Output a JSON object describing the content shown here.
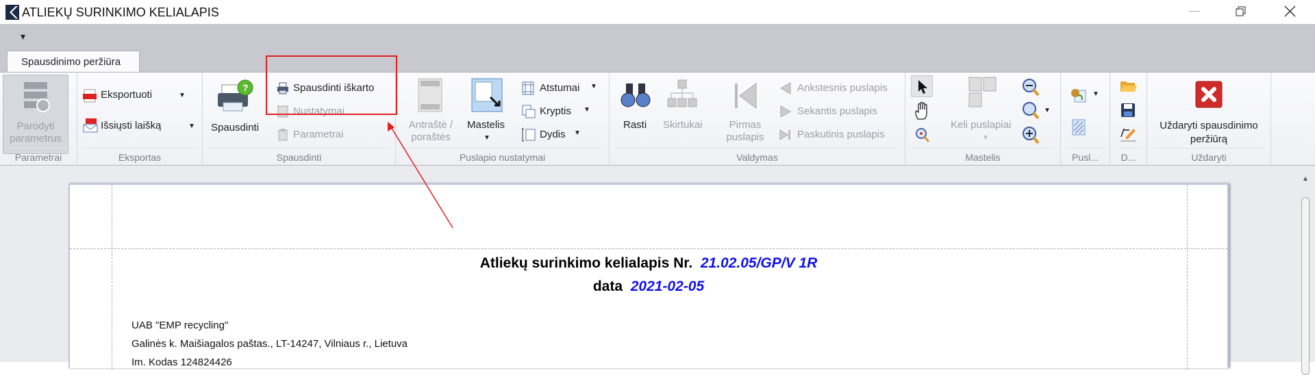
{
  "window": {
    "title": "ATLIEKŲ SURINKIMO KELIALAPIS"
  },
  "qat": {
    "customize": "▾"
  },
  "tabs": [
    {
      "label": "Spausdinimo peržiūra"
    }
  ],
  "groups": {
    "parametrai": {
      "label": "Parametrai",
      "show_params": "Parodyti parametrus"
    },
    "eksportas": {
      "label": "Eksportas",
      "export": "Eksportuoti",
      "send": "Išsiųsti laišką"
    },
    "spausdinti": {
      "label": "Spausdinti",
      "print": "Spausdinti",
      "print_now": "Spausdinti iškarto",
      "settings": "Nustatymai",
      "params": "Parametrai"
    },
    "puslapio": {
      "label": "Puslapio nustatymai",
      "header_footer": "Antraštė / poraštės",
      "scale": "Mastelis",
      "margins": "Atstumai",
      "orientation": "Kryptis",
      "size": "Dydis"
    },
    "valdymas": {
      "label": "Valdymas",
      "find": "Rasti",
      "bookmarks": "Skirtukai",
      "first": "Pirmas puslapis",
      "prev": "Ankstesnis puslapis",
      "next": "Sekantis puslapis",
      "last": "Paskutinis puslapis"
    },
    "mastelis": {
      "label": "Mastelis",
      "multi": "Keli puslapiai"
    },
    "pusl": {
      "label": "Pusl..."
    },
    "d": {
      "label": "D..."
    },
    "uzdaryti": {
      "label": "Uždaryti",
      "close": "Uždaryti spausdinimo peržiūrą"
    }
  },
  "document": {
    "title_prefix": "Atliekų surinkimo kelialapis Nr.",
    "number": "21.02.05/GP/V 1R",
    "date_label": "data",
    "date": "2021-02-05",
    "company": "UAB \"EMP recycling\"",
    "address": "Galinės k. Maišiagalos paštas., LT-14247, Vilniaus r., Lietuva",
    "code": "Im. Kodas   124824426"
  },
  "colors": {
    "accent_blue": "#1010ee",
    "annotation_red": "#e02020"
  }
}
